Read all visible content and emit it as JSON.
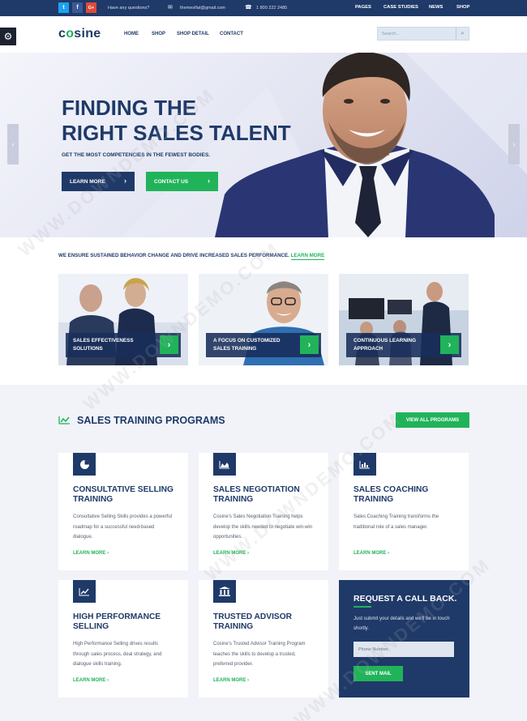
{
  "topbar": {
    "social": [
      {
        "icon": "twitter-icon",
        "glyph": "t",
        "color": "#1da1f2"
      },
      {
        "icon": "facebook-icon",
        "glyph": "f",
        "color": "#3b5998"
      },
      {
        "icon": "google-plus-icon",
        "glyph": "G+",
        "color": "#dd4b39"
      }
    ],
    "question": "Have any questions?",
    "email": "themesflat@gmail.com",
    "phone": "1 800 222 2485",
    "nav": [
      "PAGES",
      "CASE STUDIES",
      "NEWS",
      "SHOP"
    ]
  },
  "header": {
    "logo_pre": "c",
    "logo_o": "o",
    "logo_post": "sine",
    "nav": [
      "HOME",
      "SHOP",
      "SHOP DETAIL",
      "CONTACT"
    ],
    "search_placeholder": "Search..."
  },
  "hero": {
    "title_line1": "FINDING THE",
    "title_line2": "RIGHT SALES TALENT",
    "subtitle": "GET THE MOST COMPETENCIES IN THE FEWEST BODIES.",
    "btn_learn": "LEARN MORE",
    "btn_contact": "CONTACT US"
  },
  "intro": {
    "text": "WE ENSURE SUSTAINED BEHAVIOR CHANGE AND DRIVE INCREASED SALES PERFORMANCE.",
    "link": "LEARN MORE"
  },
  "tiles": [
    {
      "line1": "SALES EFFECTIVENESS",
      "line2": "SOLUTIONS"
    },
    {
      "line1": "A FOCUS ON CUSTOMIZED",
      "line2": "SALES TRAINING"
    },
    {
      "line1": "CONTINUOUS LEARNING",
      "line2": "APPROACH"
    }
  ],
  "programs": {
    "title": "SALES TRAINING PROGRAMS",
    "view_all": "VIEW ALL PROGRAMS",
    "learn_more": "LEARN MORE",
    "cards": [
      {
        "icon": "pie-chart-icon",
        "title": "CONSULTATIVE SELLING TRAINING",
        "desc": "Consultative Selling Skills provides a powerful roadmap for a successful need-based dialogue."
      },
      {
        "icon": "area-chart-icon",
        "title": "SALES NEGOTIATION TRAINING",
        "desc": "Cosine's Sales Negotiation Training helps develop the skills needed to negotiate win-win opportunities."
      },
      {
        "icon": "bar-chart-icon",
        "title": "SALES COACHING TRAINING",
        "desc": "Sales Coaching Training transforms the traditional role of a sales manager."
      },
      {
        "icon": "line-chart-icon",
        "title": "HIGH PERFORMANCE SELLING",
        "desc": "High Performance Selling drives results through sales process, deal strategy, and dialogue skills training."
      },
      {
        "icon": "bank-icon",
        "title": "TRUSTED ADVISOR TRAINING",
        "desc": "Cosine's Trusted Advisor Training Program teaches the skills to develop a trusted, preferred provider."
      }
    ]
  },
  "callback": {
    "title": "REQUEST A CALL BACK.",
    "desc": "Just submit your details and we'll be in touch shortly.",
    "placeholder": "Phone Number",
    "button": "SENT MAIL"
  },
  "watermark": "WWW.DOWNDEMO.COM",
  "colors": {
    "navy": "#1f3a68",
    "green": "#21b35a",
    "topbar": "#1f3a68"
  }
}
